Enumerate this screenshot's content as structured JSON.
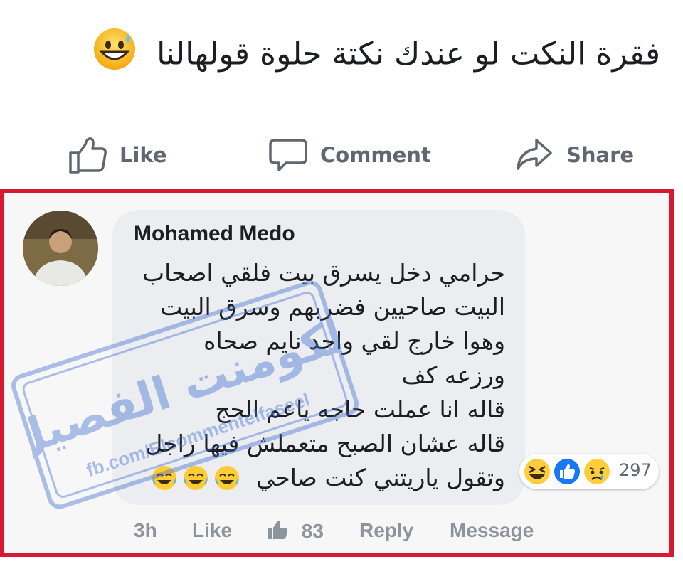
{
  "post": {
    "text": "فقرة النكت لو عندك نكتة حلوة قولهالنا",
    "emoji_icon": "grinning-sweat-emoji-icon"
  },
  "actions": {
    "like_label": "Like",
    "comment_label": "Comment",
    "share_label": "Share"
  },
  "comment": {
    "author": "Mohamed Medo",
    "lines": [
      "حرامي دخل يسرق بيت فلقي اصحاب",
      "البيت صاحيين فضربهم وسرق البيت",
      "وهوا خارج لقي واحد نايم صحاه",
      "ورزعه كف",
      "قاله انا عملت حاجه ياعم الحج",
      "قاله عشان الصبح متعملش فيها راجل",
      "وتقول ياريتني كنت صاحي"
    ],
    "trailing_emoji_icon": "tears-of-joy-emoji-icon",
    "reactions": {
      "icons": [
        "laughing-reaction-icon",
        "like-reaction-icon",
        "sad-reaction-icon"
      ],
      "count": "297"
    },
    "meta": {
      "time": "3h",
      "like_label": "Like",
      "likes_count": "83",
      "reply_label": "Reply",
      "message_label": "Message"
    }
  },
  "watermark": {
    "arabic": "الكومنت الفصيل",
    "handle": "fb.com/Elcommentelfaseel"
  },
  "colors": {
    "highlight_border": "#d71a32",
    "bubble": "#ebedf0",
    "muted_text": "#8d949e",
    "like_blue": "#1877f2"
  }
}
